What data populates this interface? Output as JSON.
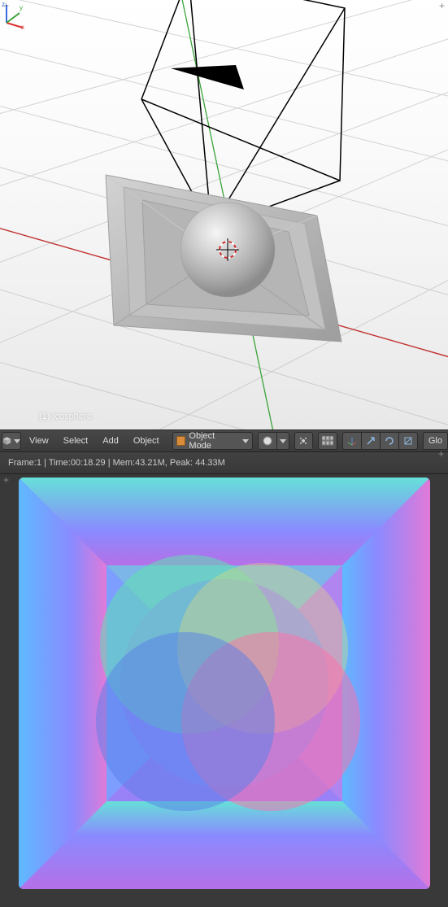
{
  "viewport3d": {
    "object_name": "(1) Icosphere"
  },
  "header": {
    "view": "View",
    "select": "Select",
    "add": "Add",
    "object": "Object",
    "mode": "Object Mode",
    "global": "Glo"
  },
  "info": {
    "status": "Frame:1 | Time:00:18.29 | Mem:43.21M, Peak: 44.33M"
  }
}
